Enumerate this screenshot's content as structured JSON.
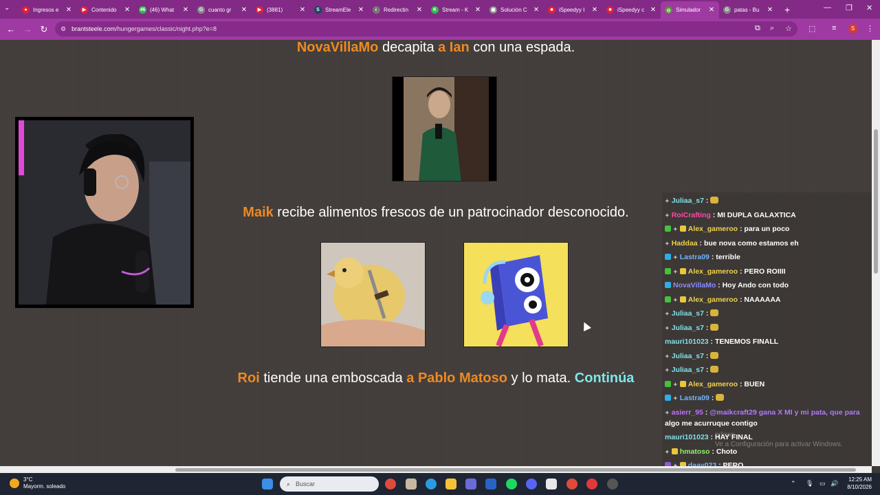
{
  "browser": {
    "tabs": [
      {
        "title": "Ingresos e",
        "fav_color": "#e0203a",
        "fav_glyph": "●"
      },
      {
        "title": "Contenido",
        "fav_color": "#e0203a",
        "fav_glyph": "▶"
      },
      {
        "title": "(46) What",
        "fav_color": "#2fb84b",
        "fav_glyph": "46"
      },
      {
        "title": "cuanto gr",
        "fav_color": "#888888",
        "fav_glyph": "G"
      },
      {
        "title": "(3881)",
        "fav_color": "#e0203a",
        "fav_glyph": "▶"
      },
      {
        "title": "StreamEle",
        "fav_color": "#16495a",
        "fav_glyph": "S"
      },
      {
        "title": "Redirectin",
        "fav_color": "#777777",
        "fav_glyph": "◐"
      },
      {
        "title": "Stream - K",
        "fav_color": "#2fb84b",
        "fav_glyph": "K"
      },
      {
        "title": "Solución C",
        "fav_color": "#888888",
        "fav_glyph": "▣"
      },
      {
        "title": "iSpeedyy I",
        "fav_color": "#e0203a",
        "fav_glyph": "■"
      },
      {
        "title": "iSpeedyy c",
        "fav_color": "#e0203a",
        "fav_glyph": "■"
      },
      {
        "title": "Simulador",
        "fav_color": "#5a8a3a",
        "fav_glyph": "◎"
      },
      {
        "title": "patas - Bu",
        "fav_color": "#888888",
        "fav_glyph": "G"
      }
    ],
    "active_tab_index": 11,
    "new_tab_label": "+",
    "url_host": "brantsteele.com",
    "url_path": "/hungergames/classic/night.php?e=8",
    "profile_initial": "S"
  },
  "game": {
    "event1": {
      "actor": "NovaVillaMo",
      "text1": " decapita ",
      "connector": "a Ian",
      "text2": " con una espada."
    },
    "event2": {
      "actor": "Maik",
      "text1": " recibe alimentos frescos de un patrocinador desconocido."
    },
    "event3": {
      "actor": "Roi",
      "text1": " tiende una emboscada ",
      "connector": "a Pablo Matoso",
      "text2": " y lo mata. ",
      "continue": "Continúa"
    }
  },
  "chat": {
    "messages": [
      {
        "badges": [
          "mod"
        ],
        "user": "Juliaa_s7",
        "user_color": "#7fe0e8",
        "text": "",
        "emote": true
      },
      {
        "badges": [
          "mod"
        ],
        "user": "RoiCrafting",
        "user_color": "#ff4aa8",
        "text": "MI DUPLA GALAXTICA",
        "emote": false
      },
      {
        "badges": [
          "green",
          "mod",
          "crown"
        ],
        "user": "Alex_gameroo",
        "user_color": "#f0d24a",
        "text": "para un poco",
        "emote": false
      },
      {
        "badges": [
          "mod"
        ],
        "user": "Haddaa",
        "user_color": "#f0d24a",
        "text": "bue nova como estamos eh",
        "emote": false
      },
      {
        "badges": [
          "blue",
          "mod"
        ],
        "user": "Lastra09",
        "user_color": "#6fb4ff",
        "text": "terrible",
        "emote": false
      },
      {
        "badges": [
          "green",
          "mod",
          "crown"
        ],
        "user": "Alex_gameroo",
        "user_color": "#f0d24a",
        "text": "PERO ROIIII",
        "emote": false
      },
      {
        "badges": [
          "blue"
        ],
        "user": "NovaVillaMo",
        "user_color": "#8a8cff",
        "text": "Hoy Ando con todo",
        "emote": false
      },
      {
        "badges": [
          "green",
          "mod",
          "crown"
        ],
        "user": "Alex_gameroo",
        "user_color": "#f0d24a",
        "text": "NAAAAAA",
        "emote": false
      },
      {
        "badges": [
          "mod"
        ],
        "user": "Juliaa_s7",
        "user_color": "#7fe0e8",
        "text": "",
        "emote": true
      },
      {
        "badges": [
          "mod"
        ],
        "user": "Juliaa_s7",
        "user_color": "#7fe0e8",
        "text": "",
        "emote": true
      },
      {
        "badges": [],
        "user": "mauri101023",
        "user_color": "#7fe0e8",
        "text": "TENEMOS FINALL",
        "emote": false
      },
      {
        "badges": [
          "mod"
        ],
        "user": "Juliaa_s7",
        "user_color": "#7fe0e8",
        "text": "",
        "emote": true
      },
      {
        "badges": [
          "mod"
        ],
        "user": "Juliaa_s7",
        "user_color": "#7fe0e8",
        "text": "",
        "emote": true
      },
      {
        "badges": [
          "green",
          "mod",
          "crown"
        ],
        "user": "Alex_gameroo",
        "user_color": "#f0d24a",
        "text": "BUEN",
        "emote": false
      },
      {
        "badges": [
          "blue",
          "mod"
        ],
        "user": "Lastra09",
        "user_color": "#6fb4ff",
        "text": "",
        "emote": true
      },
      {
        "badges": [
          "mod"
        ],
        "user": "asierr_95",
        "user_color": "#c070ff",
        "text": "@maikcraft29 gana X MI y mi pata, que para",
        "text2": "algo me acurruque contigo",
        "emote": false
      },
      {
        "badges": [],
        "user": "mauri101023",
        "user_color": "#7fe0e8",
        "text": "HAY FINAL",
        "emote": false
      },
      {
        "badges": [
          "mod",
          "crown"
        ],
        "user": "hmatoso",
        "user_color": "#8ef06a",
        "text": "Choto",
        "emote": false
      },
      {
        "badges": [
          "purple",
          "mod",
          "crown"
        ],
        "user": "daay023",
        "user_color": "#6fb4ff",
        "text": "PERO",
        "emote": false
      }
    ]
  },
  "watermark": {
    "line1": "ndows",
    "line2": "Ve a Configuración para activar Windows."
  },
  "taskbar": {
    "weather_temp": "3°C",
    "weather_desc": "Mayorm. soleado",
    "search_placeholder": "Buscar",
    "time": "12:25 AM",
    "date": "8/10/2026"
  }
}
